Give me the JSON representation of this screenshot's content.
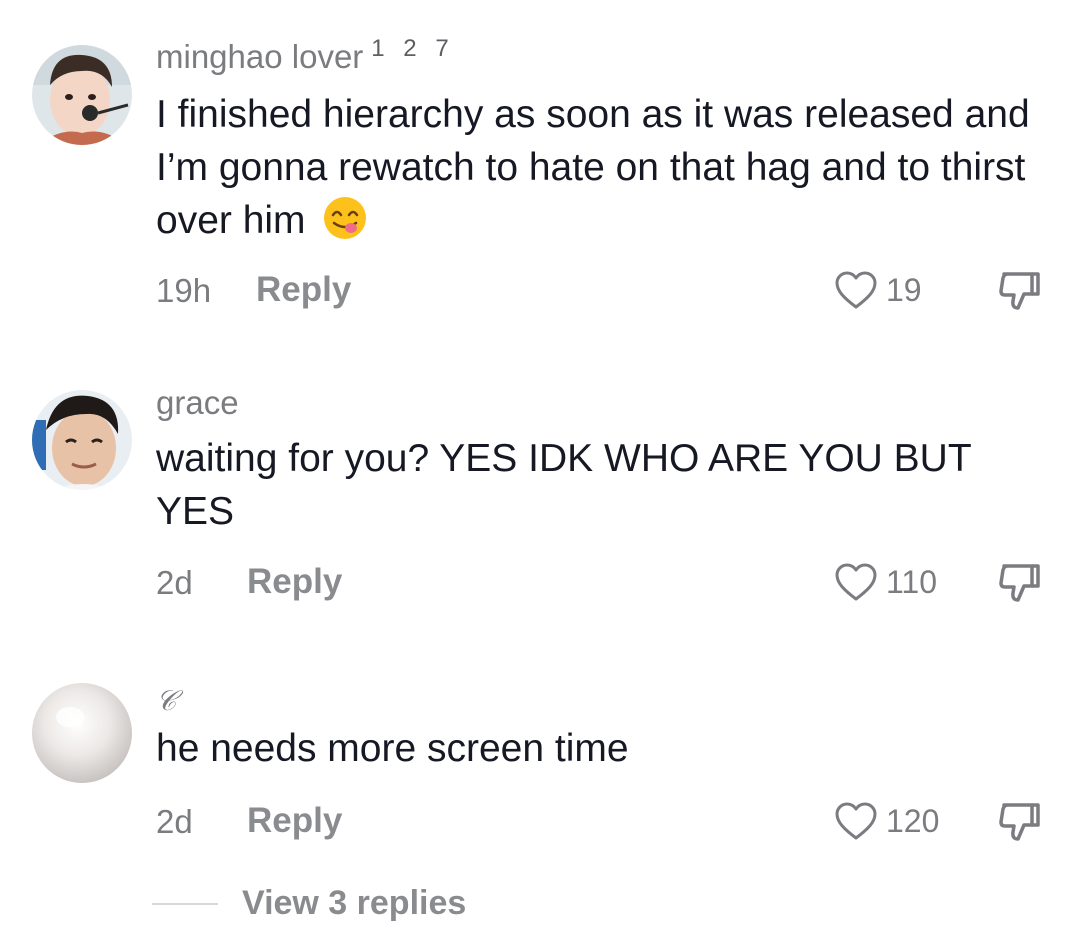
{
  "comments": [
    {
      "username": "minghao lover",
      "badge": "1 2 7",
      "text": "I finished hierarchy as soon as it was released and I’m gonna rewatch to hate on that hag and to thirst over him",
      "emoji": "yum-face",
      "time": "19h",
      "reply_label": "Reply",
      "likes": "19"
    },
    {
      "username": "grace",
      "text": "waiting for you? YES IDK WHO ARE YOU BUT YES",
      "time": "2d",
      "reply_label": "Reply",
      "likes": "110"
    },
    {
      "username": "𝒞",
      "text": "he needs more screen time",
      "time": "2d",
      "reply_label": "Reply",
      "likes": "120"
    }
  ],
  "view_replies_label": "View 3 replies",
  "colors": {
    "primary_text": "#161823",
    "secondary_text": "#7b7c80",
    "reply_text": "#8a8b8f"
  }
}
